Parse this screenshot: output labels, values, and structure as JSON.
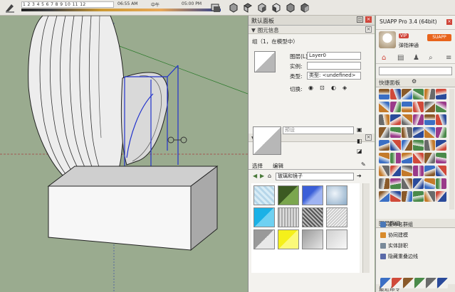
{
  "toolbar": {
    "months": "1 2 3 4 5 6 7 8 9 10 11 12",
    "time_start": "06:55 AM",
    "time_mid": "中午",
    "time_end": "05:00 PM"
  },
  "tray": {
    "title": "默认面板",
    "entity_info": {
      "header": "图元信息",
      "group_label": "组（1，在模型中）",
      "layer_label": "图层(L):",
      "layer_value": "Layer0",
      "instance_label": "实例:",
      "instance_value": "",
      "type_label": "类型:",
      "type_value": "类型: <undefined>",
      "toggle_label": "切换:"
    },
    "materials": {
      "header": "材质",
      "preview_placeholder": "预设",
      "tab_select": "选择",
      "tab_edit": "编辑",
      "library_value": "玻璃和镜子"
    }
  },
  "suapp": {
    "title": "SUAPP Pro 3.4 (64bit)",
    "vip_badge": "VIP",
    "username": "弹指神通",
    "quick_panel": "快捷面板",
    "layer_group": "图层群组",
    "menu_items": [
      "重命名群组",
      "协同建模",
      "实体辞职",
      "隐藏重叠边线"
    ],
    "recent": "最近命令"
  },
  "colors": {
    "viewport_bg": "#9aab8f",
    "selection_blue": "#2233cc",
    "suapp_orange": "#e8641c"
  }
}
